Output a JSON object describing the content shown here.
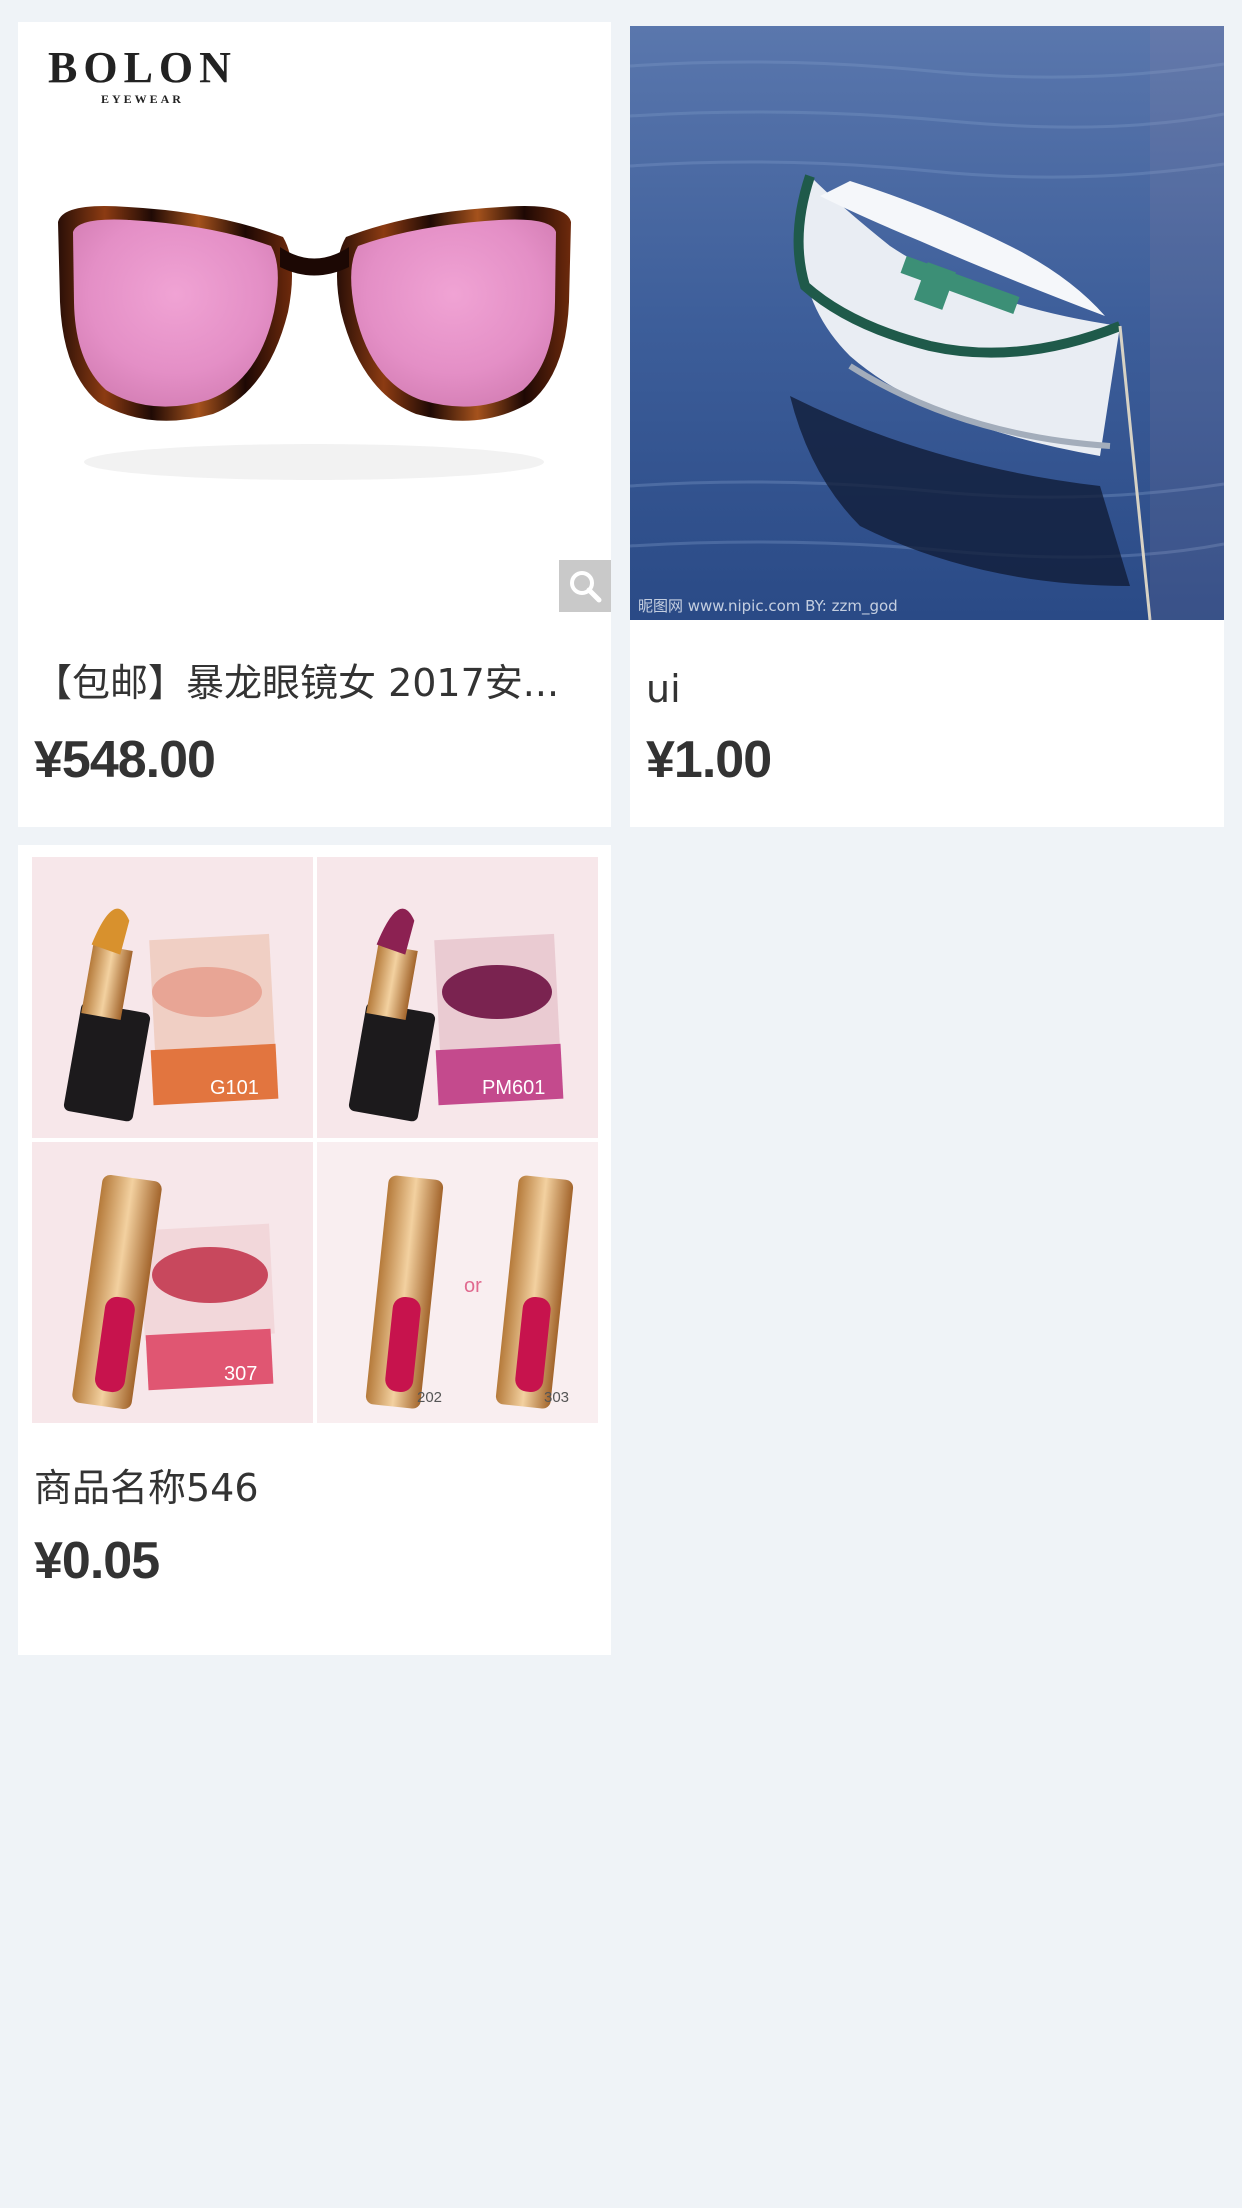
{
  "products": [
    {
      "title": "【包邮】暴龙眼镜女 2017安...",
      "price": "¥548.00",
      "brand": "BOLON",
      "brand_sub": "EYEWEAR",
      "image_icon": "sunglasses-image",
      "zoom_icon": "search-icon"
    },
    {
      "title": "ui",
      "price": "¥1.00",
      "watermark": "昵图网 www.nipic.com  BY: zzm_god",
      "image_icon": "boat-image"
    },
    {
      "title": "商品名称546",
      "price": "¥0.05",
      "image_icon": "lipstick-image",
      "shade_labels": [
        "G101",
        "PM601",
        "307",
        "202",
        "303"
      ],
      "or_label": "or"
    }
  ],
  "colors": {
    "background": "#eff3f7",
    "card": "#ffffff",
    "text": "#333333",
    "lens_pink": "#e48fc6",
    "water_blue": "#3d5e9a"
  }
}
